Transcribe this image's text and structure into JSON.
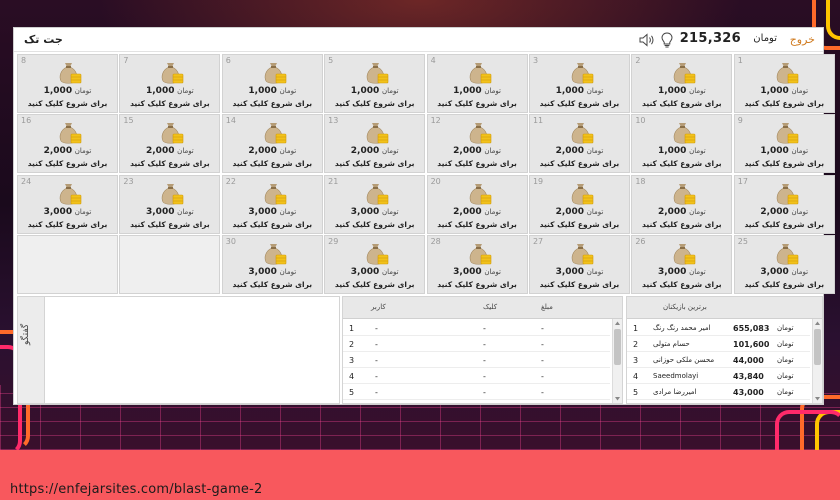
{
  "header": {
    "title": "جت تک",
    "exit_label": "خروج",
    "balance_unit": "تومان",
    "balance": "215,326",
    "hint_icon": "lightbulb-icon",
    "sound_icon": "speaker-icon"
  },
  "grid": {
    "unit": "تومان",
    "cta": "برای شروع کلیک کنید",
    "cells": [
      {
        "num": "1",
        "amount": "1,000"
      },
      {
        "num": "2",
        "amount": "1,000"
      },
      {
        "num": "3",
        "amount": "1,000"
      },
      {
        "num": "4",
        "amount": "1,000"
      },
      {
        "num": "5",
        "amount": "1,000"
      },
      {
        "num": "6",
        "amount": "1,000"
      },
      {
        "num": "7",
        "amount": "1,000"
      },
      {
        "num": "8",
        "amount": "1,000"
      },
      {
        "num": "9",
        "amount": "1,000"
      },
      {
        "num": "10",
        "amount": "1,000"
      },
      {
        "num": "11",
        "amount": "2,000"
      },
      {
        "num": "12",
        "amount": "2,000"
      },
      {
        "num": "13",
        "amount": "2,000"
      },
      {
        "num": "14",
        "amount": "2,000"
      },
      {
        "num": "15",
        "amount": "2,000"
      },
      {
        "num": "16",
        "amount": "2,000"
      },
      {
        "num": "17",
        "amount": "2,000"
      },
      {
        "num": "18",
        "amount": "2,000"
      },
      {
        "num": "19",
        "amount": "2,000"
      },
      {
        "num": "20",
        "amount": "2,000"
      },
      {
        "num": "21",
        "amount": "3,000"
      },
      {
        "num": "22",
        "amount": "3,000"
      },
      {
        "num": "23",
        "amount": "3,000"
      },
      {
        "num": "24",
        "amount": "3,000"
      },
      {
        "num": "25",
        "amount": "3,000"
      },
      {
        "num": "26",
        "amount": "3,000"
      },
      {
        "num": "27",
        "amount": "3,000"
      },
      {
        "num": "28",
        "amount": "3,000"
      },
      {
        "num": "29",
        "amount": "3,000"
      },
      {
        "num": "30",
        "amount": "3,000"
      }
    ],
    "bag_icon": "money-bag-icon"
  },
  "chat": {
    "tab_label": "گفتگو"
  },
  "clicks_table": {
    "headers": {
      "user": "کاربر",
      "click": "کلیک",
      "amount": "مبلغ"
    },
    "rows": [
      {
        "index": "1",
        "user": "-",
        "click": "-",
        "amount": "-"
      },
      {
        "index": "2",
        "user": "-",
        "click": "-",
        "amount": "-"
      },
      {
        "index": "3",
        "user": "-",
        "click": "-",
        "amount": "-"
      },
      {
        "index": "4",
        "user": "-",
        "click": "-",
        "amount": "-"
      },
      {
        "index": "5",
        "user": "-",
        "click": "-",
        "amount": "-"
      }
    ]
  },
  "leaders_table": {
    "header": "برترین بازیکنان",
    "unit": "تومان",
    "rows": [
      {
        "index": "1",
        "name": "امیر محمد رنگ رنگ",
        "amount": "655,083"
      },
      {
        "index": "2",
        "name": "حسام متولی",
        "amount": "101,600"
      },
      {
        "index": "3",
        "name": "محسن ملکی حوزانی",
        "amount": "44,000"
      },
      {
        "index": "4",
        "name": "Saeedmolayi",
        "amount": "43,840"
      },
      {
        "index": "5",
        "name": "امیررضا مرادی",
        "amount": "43,000"
      }
    ]
  },
  "footer": {
    "url": "https://enfejarsites.com/blast-game-2"
  },
  "colors": {
    "accent_exit": "#d07a1e",
    "footer_band": "#f8585d",
    "bag_gold": "#f2c21b",
    "bag_sack": "#c9b08a"
  }
}
